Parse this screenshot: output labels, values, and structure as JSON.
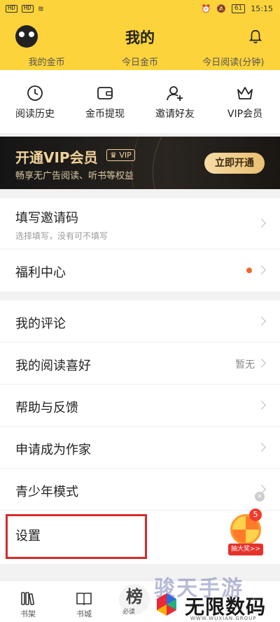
{
  "status_bar": {
    "time": "15:15",
    "battery": "61",
    "signal_1": "HD",
    "signal_2": "HD"
  },
  "header": {
    "title": "我的",
    "stats": [
      "我的金币",
      "今日金币",
      "今日阅读(分钟)"
    ]
  },
  "quick_actions": [
    {
      "label": "阅读历史",
      "icon": "clock-icon"
    },
    {
      "label": "金币提现",
      "icon": "wallet-icon"
    },
    {
      "label": "邀请好友",
      "icon": "add-user-icon"
    },
    {
      "label": "VIP会员",
      "icon": "crown-icon"
    }
  ],
  "vip_banner": {
    "title": "开通VIP会员",
    "badge": "VIP",
    "subtitle": "畅享无广告阅读、听书等权益",
    "button": "立即开通"
  },
  "menu_group_1": [
    {
      "label": "填写邀请码",
      "sub": "选择填写，没有可不填写"
    },
    {
      "label": "福利中心",
      "has_dot": true
    }
  ],
  "menu_group_2": [
    {
      "label": "我的评论"
    },
    {
      "label": "我的阅读喜好",
      "value": "暂无"
    },
    {
      "label": "帮助与反馈"
    },
    {
      "label": "申请成为作家"
    },
    {
      "label": "青少年模式"
    },
    {
      "label": "设置"
    }
  ],
  "lottery": {
    "count": "5",
    "label": "抽大奖>>"
  },
  "tabbar": {
    "items": [
      "书架",
      "书城"
    ],
    "center_char": "榜",
    "center_label": "必读"
  },
  "watermark": {
    "top_text": "骏天手游",
    "name": "无限数码",
    "url": "WWW.WUXIAN.GROUP"
  },
  "colors": {
    "header_bg": "#fcd33a",
    "vip_gold": "#f1d399",
    "dot": "#f06a2c",
    "highlight": "#d42b2b"
  }
}
